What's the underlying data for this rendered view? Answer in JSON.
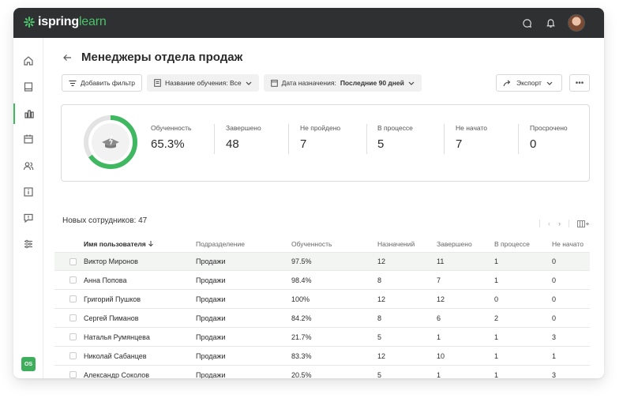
{
  "brand": {
    "name_bold": "ispring",
    "name_light": "learn"
  },
  "page": {
    "title": "Менеджеры отдела продаж"
  },
  "filters": {
    "add_filter": "Добавить фильтр",
    "course_label": "Название обучения: Все",
    "date_label": "Дата назначения:",
    "date_value": "Последние 90 дней"
  },
  "toolbar": {
    "export": "Экспорт",
    "more": "•••"
  },
  "stats": {
    "progress": {
      "label": "Обученность",
      "value": "65.3%",
      "fraction": 0.653
    },
    "completed": {
      "label": "Завершено",
      "value": "48"
    },
    "failed": {
      "label": "Не пройдено",
      "value": "7"
    },
    "in_progress": {
      "label": "В процессе",
      "value": "5"
    },
    "not_started": {
      "label": "Не начато",
      "value": "7"
    },
    "overdue": {
      "label": "Просрочено",
      "value": "0"
    }
  },
  "table": {
    "count_label": "Новых сотрудников: 47",
    "columns": {
      "name": "Имя пользователя",
      "dept": "Подразделение",
      "progress": "Обученность",
      "assigned": "Назначений",
      "completed": "Завершено",
      "in_progress": "В процессе",
      "not_started": "Не начато"
    },
    "rows": [
      {
        "name": "Виктор Миронов",
        "dept": "Продажи",
        "progress": "97.5%",
        "assigned": "12",
        "completed": "11",
        "in_progress": "1",
        "not_started": "0"
      },
      {
        "name": "Анна Попова",
        "dept": "Продажи",
        "progress": "98.4%",
        "assigned": "8",
        "completed": "7",
        "in_progress": "1",
        "not_started": "0"
      },
      {
        "name": "Григорий Пушков",
        "dept": "Продажи",
        "progress": "100%",
        "assigned": "12",
        "completed": "12",
        "in_progress": "0",
        "not_started": "0"
      },
      {
        "name": "Сергей Пиманов",
        "dept": "Продажи",
        "progress": "84.2%",
        "assigned": "8",
        "completed": "6",
        "in_progress": "2",
        "not_started": "0"
      },
      {
        "name": "Наталья Румянцева",
        "dept": "Продажи",
        "progress": "21.7%",
        "assigned": "5",
        "completed": "1",
        "in_progress": "1",
        "not_started": "3"
      },
      {
        "name": "Николай Сабанцев",
        "dept": "Продажи",
        "progress": "83.3%",
        "assigned": "12",
        "completed": "10",
        "in_progress": "1",
        "not_started": "1"
      },
      {
        "name": "Александр Соколов",
        "dept": "Продажи",
        "progress": "20.5%",
        "assigned": "5",
        "completed": "1",
        "in_progress": "1",
        "not_started": "3"
      }
    ]
  },
  "user": {
    "initials": "OS"
  },
  "colors": {
    "accent": "#3fb861",
    "topbar": "#2f3032"
  }
}
